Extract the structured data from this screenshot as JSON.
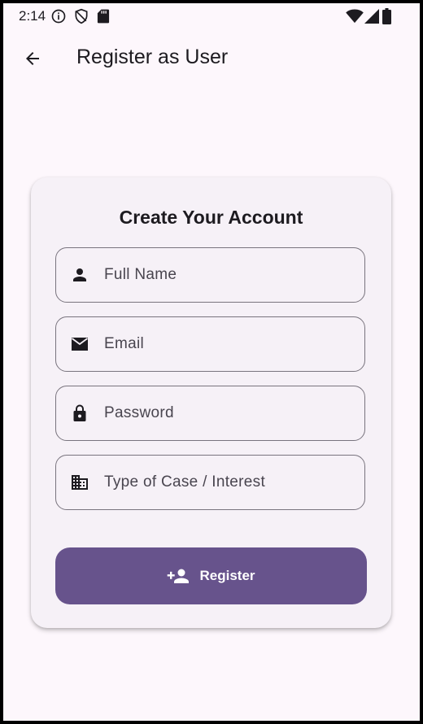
{
  "status_bar": {
    "time": "2:14",
    "icons": [
      "info-icon",
      "shield-icon",
      "sd-card-icon",
      "wifi-icon",
      "signal-icon",
      "battery-icon"
    ]
  },
  "app_bar": {
    "back_icon": "arrow-back-icon",
    "title": "Register as User"
  },
  "form": {
    "heading": "Create Your Account",
    "fields": [
      {
        "icon": "person-icon",
        "placeholder": "Full Name"
      },
      {
        "icon": "email-icon",
        "placeholder": "Email"
      },
      {
        "icon": "lock-icon",
        "placeholder": "Password"
      },
      {
        "icon": "business-icon",
        "placeholder": "Type of Case / Interest"
      }
    ],
    "submit": {
      "icon": "person-add-icon",
      "label": "Register"
    }
  },
  "colors": {
    "background": "#fdf7fc",
    "card": "#f6f1f7",
    "primary": "#67538c",
    "text": "#1d1b20",
    "outline": "#79747e"
  }
}
